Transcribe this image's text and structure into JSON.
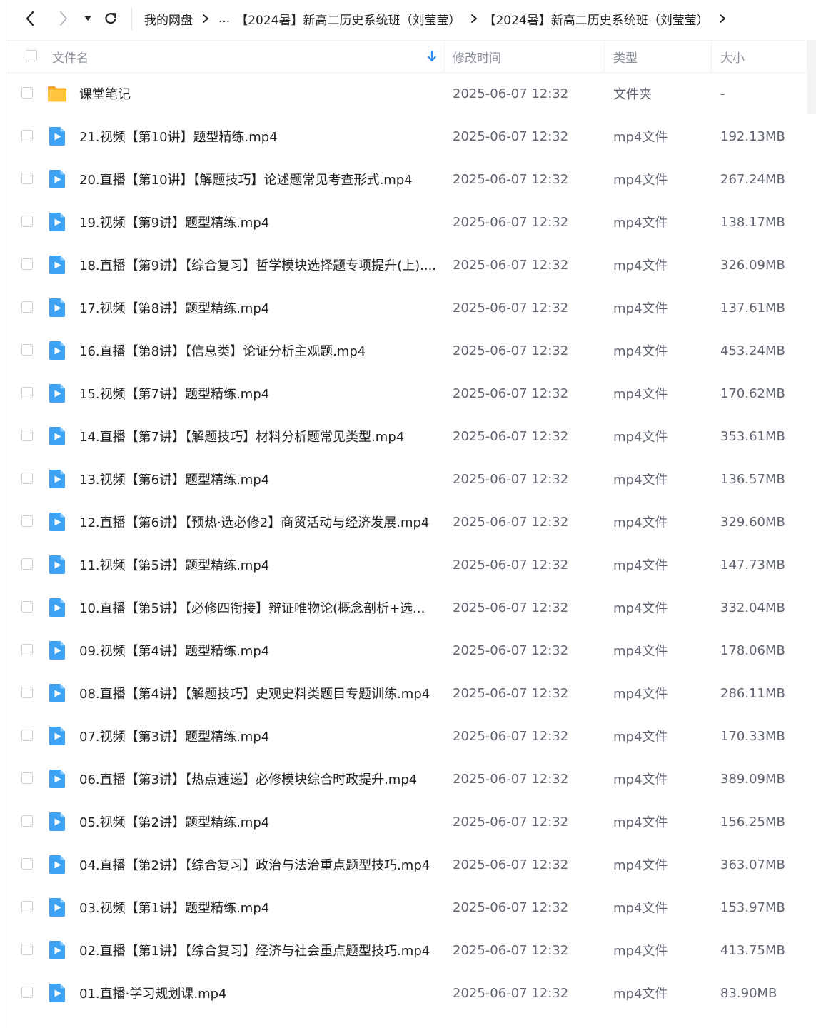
{
  "breadcrumb": {
    "items": [
      "我的网盘",
      "...",
      "【2024暑】新高二历史系统班（刘莹莹）",
      "【2024暑】新高二历史系统班（刘莹莹）"
    ]
  },
  "columns": {
    "name": "文件名",
    "modified": "修改时间",
    "type": "类型",
    "size": "大小"
  },
  "colors": {
    "accent": "#2f8cf0",
    "folder": "#ffc53d",
    "video": "#3ea3f5"
  },
  "files": [
    {
      "name": "课堂笔记",
      "modified": "2025-06-07 12:32",
      "type": "文件夹",
      "size": "-",
      "icon": "folder-icon"
    },
    {
      "name": "21.视频【第10讲】题型精练.mp4",
      "modified": "2025-06-07 12:32",
      "type": "mp4文件",
      "size": "192.13MB",
      "icon": "video-file-icon"
    },
    {
      "name": "20.直播【第10讲】【解题技巧】论述题常见考查形式.mp4",
      "modified": "2025-06-07 12:32",
      "type": "mp4文件",
      "size": "267.24MB",
      "icon": "video-file-icon"
    },
    {
      "name": "19.视频【第9讲】题型精练.mp4",
      "modified": "2025-06-07 12:32",
      "type": "mp4文件",
      "size": "138.17MB",
      "icon": "video-file-icon"
    },
    {
      "name": "18.直播【第9讲】【综合复习】哲学模块选择题专项提升(上)....",
      "modified": "2025-06-07 12:32",
      "type": "mp4文件",
      "size": "326.09MB",
      "icon": "video-file-icon"
    },
    {
      "name": "17.视频【第8讲】题型精练.mp4",
      "modified": "2025-06-07 12:32",
      "type": "mp4文件",
      "size": "137.61MB",
      "icon": "video-file-icon"
    },
    {
      "name": "16.直播【第8讲】【信息类】论证分析主观题.mp4",
      "modified": "2025-06-07 12:32",
      "type": "mp4文件",
      "size": "453.24MB",
      "icon": "video-file-icon"
    },
    {
      "name": "15.视频【第7讲】题型精练.mp4",
      "modified": "2025-06-07 12:32",
      "type": "mp4文件",
      "size": "170.62MB",
      "icon": "video-file-icon"
    },
    {
      "name": "14.直播【第7讲】【解题技巧】材料分析题常见类型.mp4",
      "modified": "2025-06-07 12:32",
      "type": "mp4文件",
      "size": "353.61MB",
      "icon": "video-file-icon"
    },
    {
      "name": "13.视频【第6讲】题型精练.mp4",
      "modified": "2025-06-07 12:32",
      "type": "mp4文件",
      "size": "136.57MB",
      "icon": "video-file-icon"
    },
    {
      "name": "12.直播【第6讲】【预热·选必修2】商贸活动与经济发展.mp4",
      "modified": "2025-06-07 12:32",
      "type": "mp4文件",
      "size": "329.60MB",
      "icon": "video-file-icon"
    },
    {
      "name": "11.视频【第5讲】题型精练.mp4",
      "modified": "2025-06-07 12:32",
      "type": "mp4文件",
      "size": "147.73MB",
      "icon": "video-file-icon"
    },
    {
      "name": "10.直播【第5讲】【必修四衔接】辩证唯物论(概念剖析+选...",
      "modified": "2025-06-07 12:32",
      "type": "mp4文件",
      "size": "332.04MB",
      "icon": "video-file-icon"
    },
    {
      "name": "09.视频【第4讲】题型精练.mp4",
      "modified": "2025-06-07 12:32",
      "type": "mp4文件",
      "size": "178.06MB",
      "icon": "video-file-icon"
    },
    {
      "name": "08.直播【第4讲】【解题技巧】史观史料类题目专题训练.mp4",
      "modified": "2025-06-07 12:32",
      "type": "mp4文件",
      "size": "286.11MB",
      "icon": "video-file-icon"
    },
    {
      "name": "07.视频【第3讲】题型精练.mp4",
      "modified": "2025-06-07 12:32",
      "type": "mp4文件",
      "size": "170.33MB",
      "icon": "video-file-icon"
    },
    {
      "name": "06.直播【第3讲】【热点速递】必修模块综合时政提升.mp4",
      "modified": "2025-06-07 12:32",
      "type": "mp4文件",
      "size": "389.09MB",
      "icon": "video-file-icon"
    },
    {
      "name": "05.视频【第2讲】题型精练.mp4",
      "modified": "2025-06-07 12:32",
      "type": "mp4文件",
      "size": "156.25MB",
      "icon": "video-file-icon"
    },
    {
      "name": "04.直播【第2讲】【综合复习】政治与法治重点题型技巧.mp4",
      "modified": "2025-06-07 12:32",
      "type": "mp4文件",
      "size": "363.07MB",
      "icon": "video-file-icon"
    },
    {
      "name": "03.视频【第1讲】题型精练.mp4",
      "modified": "2025-06-07 12:32",
      "type": "mp4文件",
      "size": "153.97MB",
      "icon": "video-file-icon"
    },
    {
      "name": "02.直播【第1讲】【综合复习】经济与社会重点题型技巧.mp4",
      "modified": "2025-06-07 12:32",
      "type": "mp4文件",
      "size": "413.75MB",
      "icon": "video-file-icon"
    },
    {
      "name": "01.直播·学习规划课.mp4",
      "modified": "2025-06-07 12:32",
      "type": "mp4文件",
      "size": "83.90MB",
      "icon": "video-file-icon"
    }
  ]
}
